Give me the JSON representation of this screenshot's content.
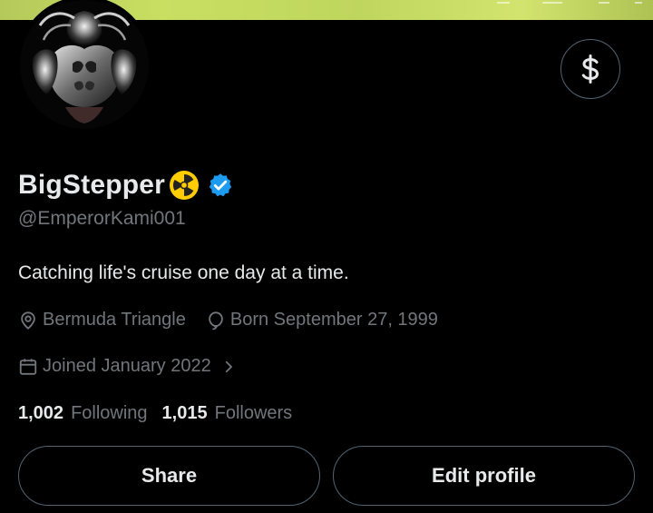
{
  "profile": {
    "display_name": "BigStepper",
    "name_emoji": "☢️",
    "handle": "@EmperorKami001",
    "bio": "Catching life's cruise one day at a time.",
    "location": "Bermuda Triangle",
    "birthday": "Born September 27, 1999",
    "joined": "Joined January 2022",
    "verified": true
  },
  "stats": {
    "following_count": "1,002",
    "following_label": "Following",
    "followers_count": "1,015",
    "followers_label": "Followers"
  },
  "actions": {
    "share_label": "Share",
    "edit_label": "Edit profile"
  },
  "icons": {
    "tip": "dollar-icon",
    "verified": "verified-badge-icon",
    "location": "location-pin-icon",
    "birthday": "balloon-icon",
    "joined": "calendar-icon",
    "joined_more": "chevron-right-icon"
  },
  "colors": {
    "background": "#000000",
    "text_primary": "#e7e9ea",
    "text_secondary": "#71767b",
    "border": "#536471",
    "verified_blue": "#1d9bf0",
    "radiation_yellow": "#ffcc00"
  }
}
